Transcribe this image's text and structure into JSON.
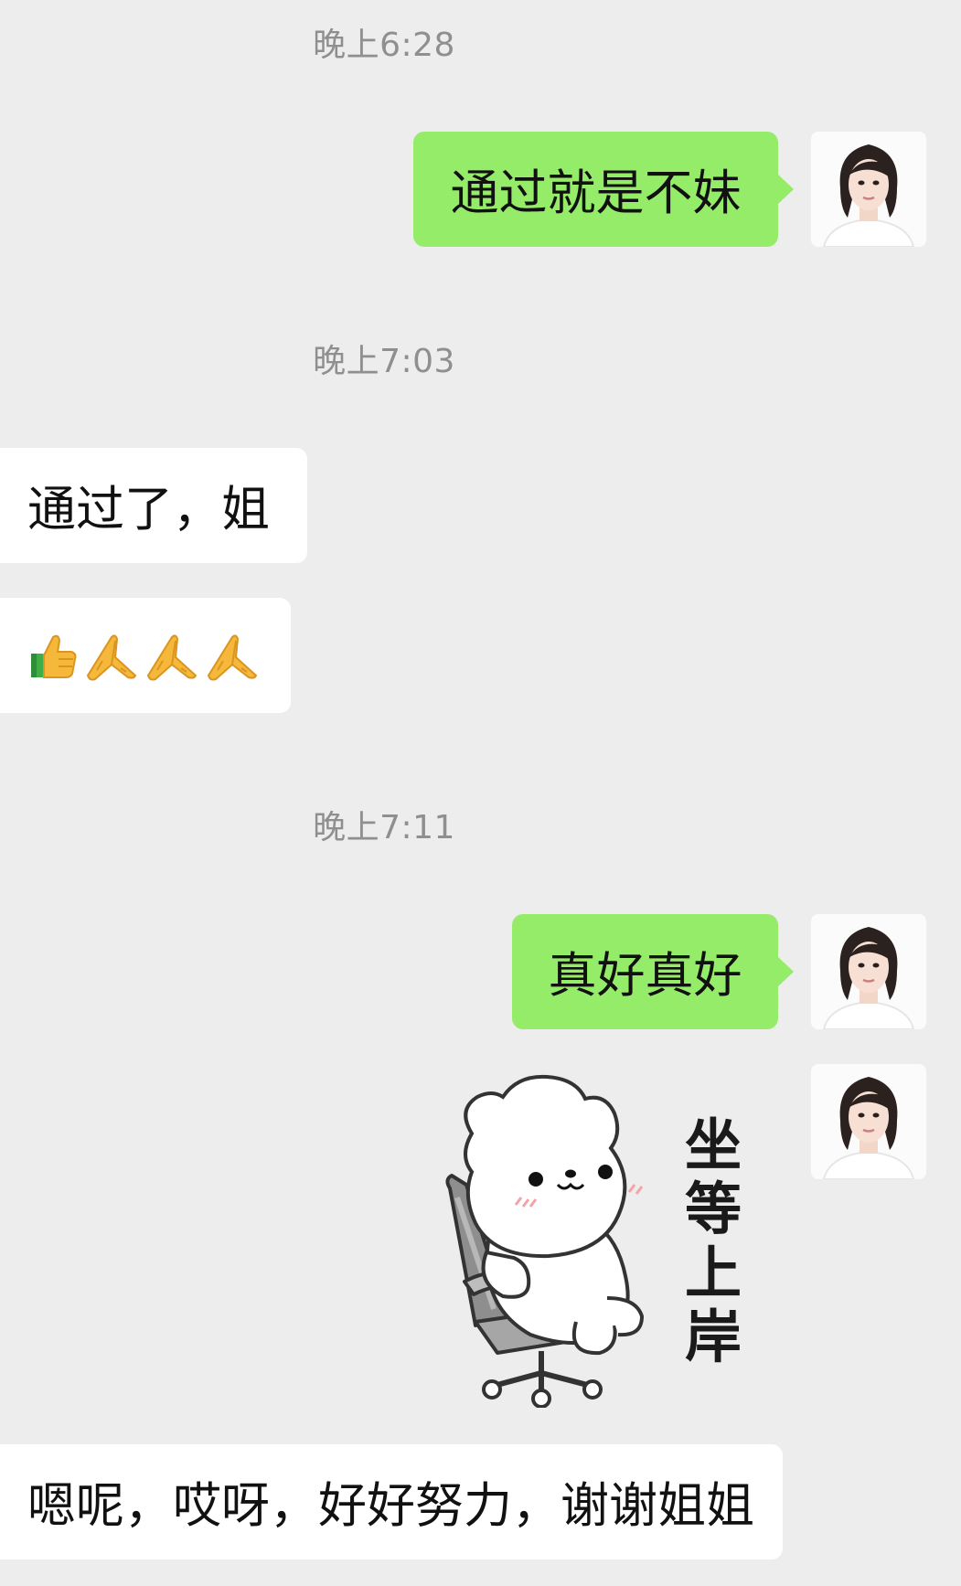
{
  "messages": [
    {
      "type": "timestamp",
      "text": "晚上6:28"
    },
    {
      "type": "outgoing",
      "text": "通过就是不妹",
      "avatar": "profile-photo"
    },
    {
      "type": "timestamp",
      "text": "晚上7:03"
    },
    {
      "type": "incoming",
      "text": "通过了，姐"
    },
    {
      "type": "incoming-emoji",
      "icons": [
        "thumbs-up-icon",
        "praying-hands-icon",
        "praying-hands-icon",
        "praying-hands-icon"
      ]
    },
    {
      "type": "timestamp",
      "text": "晚上7:11"
    },
    {
      "type": "outgoing",
      "text": "真好真好",
      "avatar": "profile-photo"
    },
    {
      "type": "outgoing-sticker",
      "sticker": "bear-sitting-in-chair",
      "text": [
        "坐",
        "等",
        "上",
        "岸"
      ],
      "avatar": "profile-photo"
    },
    {
      "type": "incoming",
      "text": "嗯呢，哎呀，好好努力，谢谢姐姐"
    }
  ],
  "colors": {
    "background": "#ededed",
    "outgoing_bubble": "#95ec69",
    "incoming_bubble": "#ffffff",
    "timestamp_text": "#8f8f8f"
  }
}
